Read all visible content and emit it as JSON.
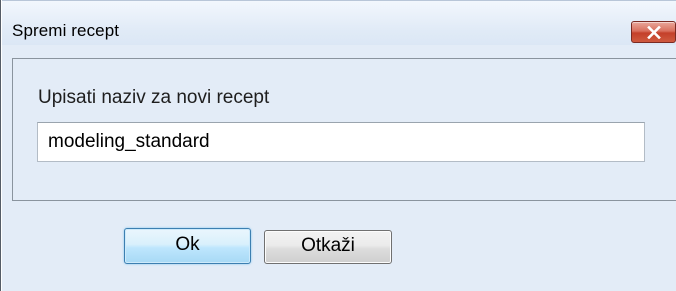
{
  "window": {
    "title": "Spremi recept",
    "close_icon": "close-icon"
  },
  "form": {
    "prompt_label": "Upisati naziv za novi recept",
    "name_value": "modeling_standard"
  },
  "buttons": {
    "ok_label": "Ok",
    "cancel_label": "Otkaži"
  },
  "colors": {
    "title_bar": "#dbe6f4",
    "client_background": "#e3ecf7",
    "close_button": "#c94f3a",
    "default_button_border": "#3c7fb1"
  }
}
